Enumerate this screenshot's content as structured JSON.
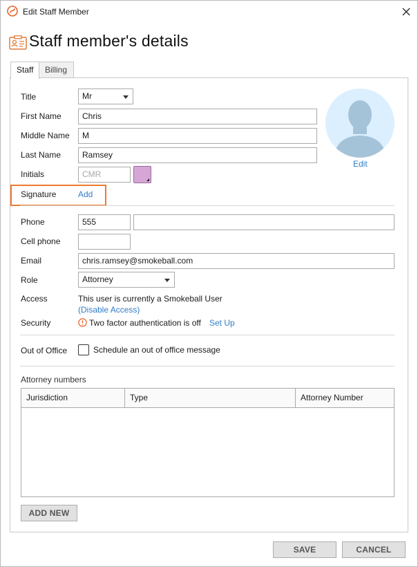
{
  "window": {
    "title": "Edit Staff Member"
  },
  "header": {
    "title": "Staff member's details"
  },
  "tabs": [
    {
      "label": "Staff",
      "active": true
    },
    {
      "label": "Billing",
      "active": false
    }
  ],
  "form": {
    "title_label": "Title",
    "title_value": "Mr",
    "first_name_label": "First Name",
    "first_name_value": "Chris",
    "middle_name_label": "Middle Name",
    "middle_name_value": "M",
    "last_name_label": "Last Name",
    "last_name_value": "Ramsey",
    "initials_label": "Initials",
    "initials_placeholder": "CMR",
    "initials_color": "#d5a6d6",
    "signature_label": "Signature",
    "signature_add": "Add",
    "phone_label": "Phone",
    "phone_value": "555",
    "phone_ext_value": "",
    "cell_label": "Cell phone",
    "cell_value": "",
    "email_label": "Email",
    "email_value": "chris.ramsey@smokeball.com",
    "role_label": "Role",
    "role_value": "Attorney",
    "access_label": "Access",
    "access_text": "This user is currently a Smokeball User",
    "access_link": "(Disable Access)",
    "security_label": "Security",
    "security_text": "Two factor authentication is off",
    "security_link": "Set Up",
    "ooo_label": "Out of Office",
    "ooo_checkbox_label": "Schedule an out of office message"
  },
  "avatar": {
    "edit_label": "Edit"
  },
  "attorney_numbers": {
    "label": "Attorney numbers",
    "columns": [
      "Jurisdiction",
      "Type",
      "Attorney Number"
    ],
    "rows": []
  },
  "buttons": {
    "add_new": "ADD NEW",
    "save": "SAVE",
    "cancel": "CANCEL"
  },
  "colors": {
    "accent": "#ee7a2d",
    "link": "#2f7bc8",
    "avatar_bg": "#dcefff",
    "avatar_figure": "#a5c3d8"
  }
}
